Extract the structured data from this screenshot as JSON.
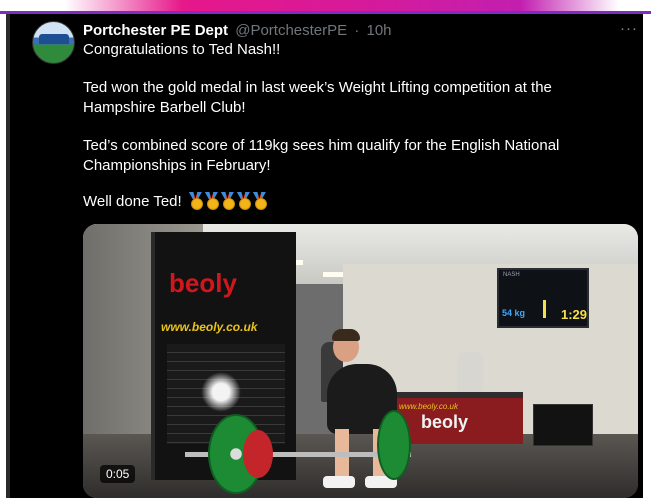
{
  "tweet": {
    "author_name": "Portchester PE Dept",
    "handle": "@PortchesterPE",
    "separator": "·",
    "time": "10h",
    "more_label": "···",
    "line1": "Congratulations to Ted Nash!!",
    "line2": "Ted won the gold medal in last week’s Weight Lifting competition at the Hampshire Barbell Club!",
    "line3": "Ted’s combined score of 119kg sees him qualify for the English National Championships in February!",
    "line4": "Well done Ted!",
    "emojis": [
      "gold-medal",
      "gold-medal",
      "gold-medal",
      "gold-medal",
      "gold-medal"
    ]
  },
  "media": {
    "video_timestamp": "0:05",
    "banner_logo": "beoly",
    "banner_url": "www.beoly.co.uk",
    "table_url": "www.beoly.co.uk",
    "table_logo": "beoly",
    "scoreboard": {
      "name": "NASH",
      "weight": "54 kg",
      "time": "1:29"
    }
  },
  "colors": {
    "card_background": "#000000",
    "text_primary": "#ffffff",
    "text_secondary": "#71767b",
    "banner_pink": "#e6188a",
    "banner_purple": "#7d2cc4"
  }
}
